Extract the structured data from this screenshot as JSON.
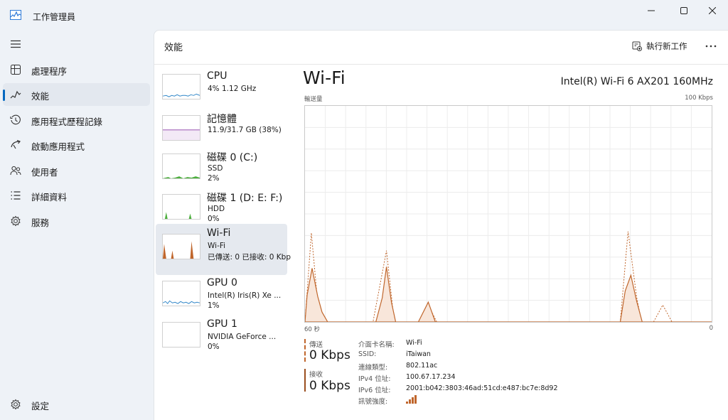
{
  "window": {
    "title": "工作管理員"
  },
  "nav": {
    "items": [
      {
        "label": "處理程序",
        "icon": "processes-icon"
      },
      {
        "label": "效能",
        "icon": "performance-icon",
        "active": true
      },
      {
        "label": "應用程式歷程記錄",
        "icon": "history-icon"
      },
      {
        "label": "啟動應用程式",
        "icon": "startup-icon"
      },
      {
        "label": "使用者",
        "icon": "users-icon"
      },
      {
        "label": "詳細資料",
        "icon": "details-icon"
      },
      {
        "label": "服務",
        "icon": "services-icon"
      }
    ],
    "settings_label": "設定"
  },
  "header": {
    "title": "效能",
    "run_task_label": "執行新工作"
  },
  "tiles": [
    {
      "name": "CPU",
      "line1": "4%  1.12 GHz",
      "line2": ""
    },
    {
      "name": "記憶體",
      "line1": "11.9/31.7 GB (38%)",
      "line2": ""
    },
    {
      "name": "磁碟 0 (C:)",
      "line1": "SSD",
      "line2": "2%"
    },
    {
      "name": "磁碟 1 (D: E: F:)",
      "line1": "HDD",
      "line2": "0%"
    },
    {
      "name": "Wi-Fi",
      "line1": "Wi-Fi",
      "line2": "已傳送: 0 已接收: 0 Kbp",
      "selected": true
    },
    {
      "name": "GPU 0",
      "line1": "Intel(R) Iris(R) Xe ...",
      "line2": "1%"
    },
    {
      "name": "GPU 1",
      "line1": "NVIDIA GeForce ...",
      "line2": "0%"
    }
  ],
  "detail": {
    "title": "Wi-Fi",
    "adapter": "Intel(R) Wi-Fi 6 AX201 160MHz",
    "graph_label": "輸送量",
    "graph_max": "100 Kbps",
    "time_label": "60 秒",
    "zero_label": "0",
    "send_label": "傳送",
    "send_value": "0 Kbps",
    "recv_label": "接收",
    "recv_value": "0 Kbps",
    "info": [
      {
        "label": "介面卡名稱:",
        "value": "Wi-Fi"
      },
      {
        "label": "SSID:",
        "value": "iTaiwan"
      },
      {
        "label": "連線類型:",
        "value": "802.11ac"
      },
      {
        "label": "IPv4 位址:",
        "value": "100.67.17.234"
      },
      {
        "label": "IPv6 位址:",
        "value": "2001:b042:3803:46ad:51cd:e487:bc7e:8d92"
      },
      {
        "label": "訊號強度:",
        "value": "",
        "signal_bars": 4
      }
    ]
  },
  "colors": {
    "accent": "#0067c0",
    "wifi": "#c0662c",
    "cpu": "#2f86c8",
    "memory": "#8b3aa8",
    "disk": "#4caf3d"
  }
}
